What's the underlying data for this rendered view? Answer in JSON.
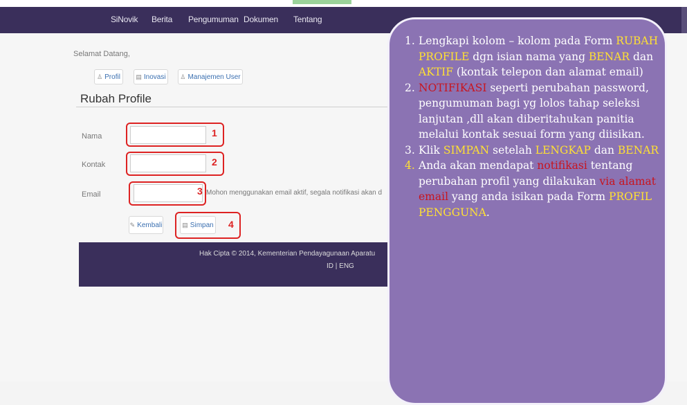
{
  "navbar": {
    "items": [
      "SiNovik",
      "Berita",
      "Pengumuman",
      "Dokumen",
      "Tentang"
    ]
  },
  "welcome": "Selamat Datang,",
  "tabs": [
    {
      "label": "Profil",
      "icon": "user-icon"
    },
    {
      "label": "Inovasi",
      "icon": "list-icon"
    },
    {
      "label": "Manajemen User",
      "icon": "users-icon"
    }
  ],
  "form": {
    "title": "Rubah Profile",
    "fields": [
      {
        "label": "Nama",
        "value": "",
        "marker": "1"
      },
      {
        "label": "Kontak",
        "value": "",
        "marker": "2"
      },
      {
        "label": "Email",
        "value": "",
        "marker": "3"
      }
    ],
    "email_hint": "Mohon menggunakan email aktif, segala notifikasi akan d",
    "back_label": "Kembali",
    "save_label": "Simpan",
    "save_marker": "4"
  },
  "footer": {
    "copyright": "Hak Cipta © 2014, Kementerian Pendayagunaan Aparatu",
    "lang": "ID | ENG"
  },
  "callout": {
    "colors": {
      "background": "#8b73b3",
      "highlight": "#ffe033",
      "alert": "#c8141e"
    },
    "item1": {
      "num": "1.",
      "t1": "Lengkapi  kolom – kolom pada Form ",
      "h1": "RUBAH PROFILE",
      "t2": " dgn isian nama yang ",
      "h2": "BENAR",
      "t3": " dan ",
      "h3": "AKTIF",
      "t4": " (kontak telepon dan alamat email)"
    },
    "item2": {
      "num": "2.",
      "h1": "NOTIFIKASI",
      "t1": " seperti perubahan password, pengumuman bagi yg lolos tahap seleksi lanjutan ,dll akan diberitahukan panitia melalui kontak sesuai form yang diisikan."
    },
    "item3": {
      "num": "3.",
      "t1": "Klik ",
      "h1": "SIMPAN",
      "t2": " setelah ",
      "h2": "LENGKAP",
      "t3": " dan ",
      "h3": "BENAR"
    },
    "item4": {
      "num": "4.",
      "t1": "Anda akan mendapat ",
      "h1": "notifikasi",
      "t2": " tentang perubahan profil yang dilakukan ",
      "h2": "via alamat email",
      "t3": " yang anda isikan pada Form ",
      "h3": "PROFIL PENGGUNA",
      "t4": "."
    }
  }
}
